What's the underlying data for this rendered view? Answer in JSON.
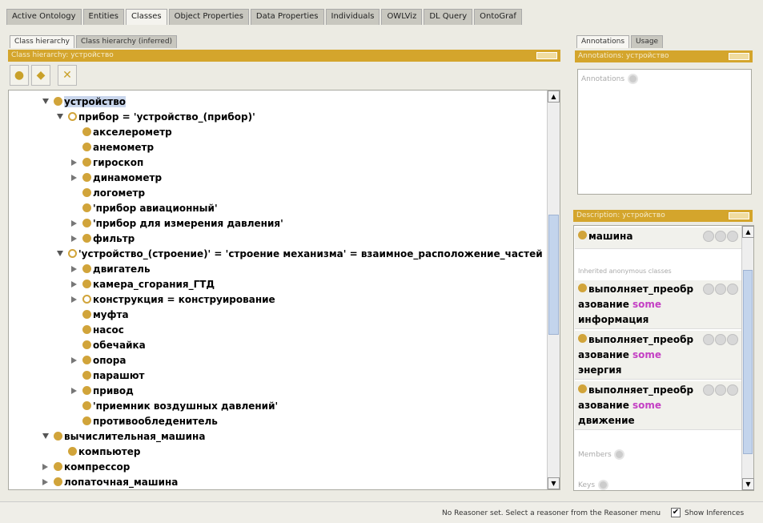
{
  "tabs": [
    "Active Ontology",
    "Entities",
    "Classes",
    "Object Properties",
    "Data Properties",
    "Individuals",
    "OWLViz",
    "DL Query",
    "OntoGraf"
  ],
  "left": {
    "subtabs": [
      "Class hierarchy",
      "Class hierarchy (inferred)"
    ],
    "header": "Class hierarchy: устройство"
  },
  "tree": [
    {
      "label": "устройство",
      "level": 0,
      "state": "exp",
      "selected": true
    },
    {
      "label": "прибор = 'устройство_(прибор)'",
      "level": 1,
      "state": "exp",
      "eq": true
    },
    {
      "label": "акселерометр",
      "level": 2,
      "state": "leaf"
    },
    {
      "label": "анемометр",
      "level": 2,
      "state": "leaf"
    },
    {
      "label": "гироскоп",
      "level": 2,
      "state": "col"
    },
    {
      "label": "динамометр",
      "level": 2,
      "state": "col"
    },
    {
      "label": "логометр",
      "level": 2,
      "state": "leaf"
    },
    {
      "label": "'прибор авиационный'",
      "level": 2,
      "state": "leaf"
    },
    {
      "label": "'прибор для измерения давления'",
      "level": 2,
      "state": "col"
    },
    {
      "label": "фильтр",
      "level": 2,
      "state": "col"
    },
    {
      "label": "'устройство_(строение)' = 'строение механизма' = взаимное_расположение_частей",
      "level": 1,
      "state": "exp",
      "eq": true
    },
    {
      "label": "двигатель",
      "level": 2,
      "state": "col"
    },
    {
      "label": "камера_сгорания_ГТД",
      "level": 2,
      "state": "col"
    },
    {
      "label": "конструкция = конструирование",
      "level": 2,
      "state": "col",
      "eq": true
    },
    {
      "label": "муфта",
      "level": 2,
      "state": "leaf"
    },
    {
      "label": "насос",
      "level": 2,
      "state": "leaf"
    },
    {
      "label": "обечайка",
      "level": 2,
      "state": "leaf"
    },
    {
      "label": "опора",
      "level": 2,
      "state": "col"
    },
    {
      "label": "парашют",
      "level": 2,
      "state": "leaf"
    },
    {
      "label": "привод",
      "level": 2,
      "state": "col"
    },
    {
      "label": "'приемник воздушных давлений'",
      "level": 2,
      "state": "leaf"
    },
    {
      "label": "противообледенитель",
      "level": 2,
      "state": "leaf"
    },
    {
      "label": "вычислительная_машина",
      "level": 0,
      "state": "exp"
    },
    {
      "label": "компьютер",
      "level": 1,
      "state": "leaf"
    },
    {
      "label": "компрессор",
      "level": 0,
      "state": "col"
    },
    {
      "label": "лопаточная_машина",
      "level": 0,
      "state": "col"
    }
  ],
  "right": {
    "tabs": [
      "Annotations",
      "Usage"
    ],
    "annotations_header": "Annotations: устройство",
    "annotations_label": "Annotations",
    "description_header": "Description: устройство",
    "superclass": "машина",
    "inherited_label": "Inherited anonymous classes",
    "restrictions": [
      {
        "l1": "выполняет_преобр",
        "l2": "азование",
        "kw": "some",
        "l3": "информация"
      },
      {
        "l1": "выполняет_преобр",
        "l2": "азование",
        "kw": "some",
        "l3": "энергия"
      },
      {
        "l1": "выполняет_преобр",
        "l2": "азование",
        "kw": "some",
        "l3": "движение"
      }
    ],
    "members_label": "Members",
    "keys_label": "Keys"
  },
  "status": {
    "text": "No Reasoner set. Select a reasoner from the Reasoner menu",
    "show_inferences": "Show Inferences",
    "show_inferences_checked": true
  }
}
